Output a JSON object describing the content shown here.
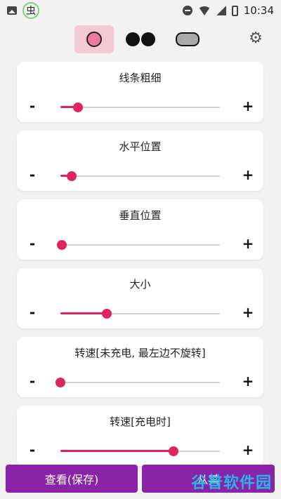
{
  "statusbar": {
    "time": "10:34",
    "bug_glyph": "虫"
  },
  "modes": [
    {
      "name": "circle",
      "icon": "circle-icon",
      "selected": true
    },
    {
      "name": "eyes",
      "icon": "eyes-icon",
      "selected": false
    },
    {
      "name": "pill",
      "icon": "pill-icon",
      "selected": false
    }
  ],
  "settings": {
    "icon": "gear-icon"
  },
  "sliders": [
    {
      "label": "线条粗细",
      "value": 0.11
    },
    {
      "label": "水平位置",
      "value": 0.07
    },
    {
      "label": "垂直位置",
      "value": 0.01
    },
    {
      "label": "大小",
      "value": 0.29
    },
    {
      "label": "转速[未充电, 最左边不旋转]",
      "value": 0.0
    },
    {
      "label": "转速[充电时]",
      "value": 0.71
    }
  ],
  "controls": {
    "minus": "-",
    "plus": "+"
  },
  "buttons": {
    "save": "查看(保存)",
    "other": "从其"
  },
  "watermark": "谷普软件园",
  "colors": {
    "accent": "#e0245e",
    "button": "#8b23a6",
    "selected_mode_bg": "#f3c9d4"
  }
}
